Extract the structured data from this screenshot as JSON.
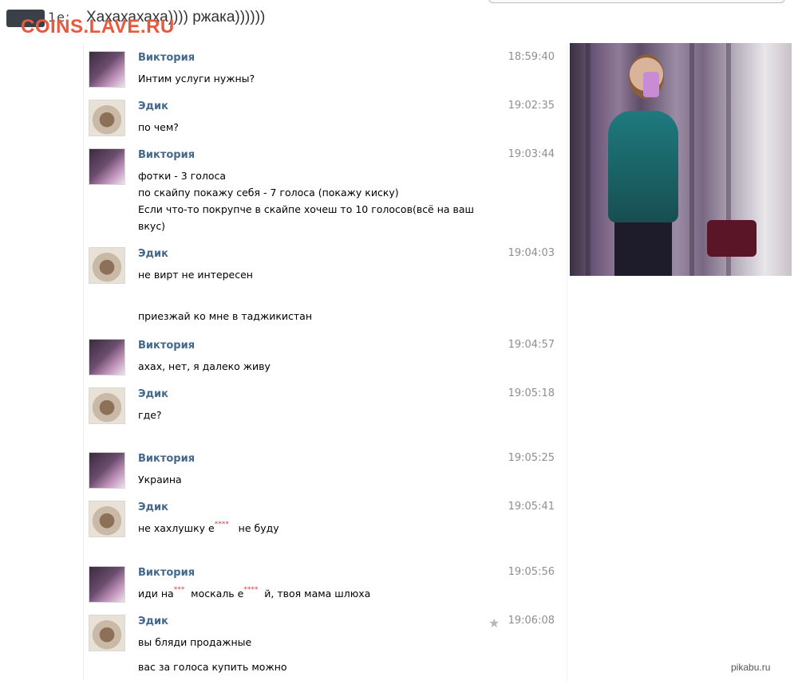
{
  "top": {
    "sender_fragment": "1e:",
    "text": "Хахахахаха)))) ржака))))))",
    "watermark": "COINS.LAVE.RU"
  },
  "messages": [
    {
      "sender": "Виктория",
      "time": "18:59:40",
      "lines": [
        "Интим услуги нужны?"
      ]
    },
    {
      "sender": "Эдик",
      "time": "19:02:35",
      "lines": [
        "по чем?"
      ]
    },
    {
      "sender": "Виктория",
      "time": "19:03:44",
      "lines": [
        "фотки - 3 голоса",
        "по скайпу покажу себя - 7 голоса (покажу киску)",
        "Если что-то покрупче в скайпе хочеш то 10 голосов(всё на ваш",
        "вкус)"
      ]
    },
    {
      "sender": "Эдик",
      "time": "19:04:03",
      "lines": [
        "не вирт не интересен",
        "приезжай ко мне в таджикистан"
      ]
    },
    {
      "sender": "Виктория",
      "time": "19:04:57",
      "lines": [
        "ахах, нет, я далеко живу"
      ]
    },
    {
      "sender": "Эдик",
      "time": "19:05:18",
      "lines": [
        "где?"
      ]
    },
    {
      "sender": "Виктория",
      "time": "19:05:25",
      "lines": [
        "Украина"
      ]
    },
    {
      "sender": "Эдик",
      "time": "19:05:41",
      "line_a": "не хахлушку е",
      "censor_a": "****",
      "line_b": "не буду"
    },
    {
      "sender": "Виктория",
      "time": "19:05:56",
      "part1": "иди на",
      "censor1": "***",
      "part2": "москаль е",
      "censor2": "****",
      "part3": "й, твоя мама шлюха"
    },
    {
      "sender": "Эдик",
      "time": "19:06:08",
      "lines": [
        "вы бляди продажные",
        "вас за голоса купить можно"
      ]
    }
  ],
  "icons": {
    "star": "star-icon"
  },
  "footer": {
    "mark": "pikabu.ru"
  }
}
